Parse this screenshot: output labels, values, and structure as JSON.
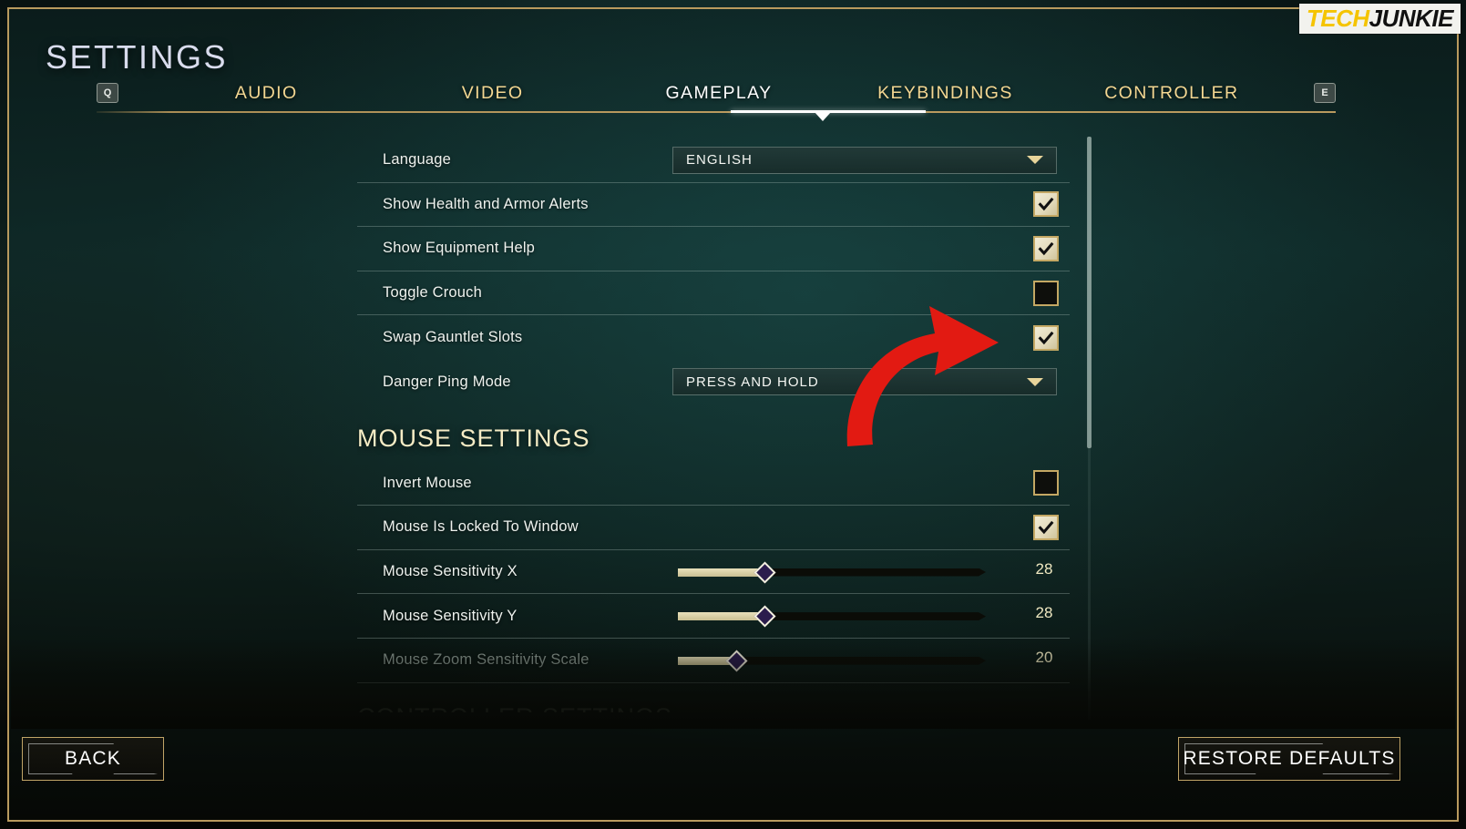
{
  "watermark": {
    "part1": "TECH",
    "part2": "JUNKIE"
  },
  "header": {
    "title": "SETTINGS",
    "key_hint_left": "Q",
    "key_hint_right": "E"
  },
  "tabs": [
    {
      "label": "AUDIO",
      "active": false
    },
    {
      "label": "VIDEO",
      "active": false
    },
    {
      "label": "GAMEPLAY",
      "active": true
    },
    {
      "label": "KEYBINDINGS",
      "active": false
    },
    {
      "label": "CONTROLLER",
      "active": false
    }
  ],
  "settings": {
    "language": {
      "label": "Language",
      "value": "ENGLISH"
    },
    "health_alerts": {
      "label": "Show Health and Armor Alerts",
      "checked": true
    },
    "equipment_help": {
      "label": "Show Equipment Help",
      "checked": true
    },
    "toggle_crouch": {
      "label": "Toggle Crouch",
      "checked": false
    },
    "swap_gauntlet": {
      "label": "Swap Gauntlet Slots",
      "checked": true
    },
    "danger_ping": {
      "label": "Danger Ping Mode",
      "value": "PRESS AND HOLD"
    },
    "mouse_heading": "MOUSE SETTINGS",
    "invert_mouse": {
      "label": "Invert Mouse",
      "checked": false
    },
    "mouse_locked": {
      "label": "Mouse Is Locked To Window",
      "checked": true
    },
    "sens_x": {
      "label": "Mouse Sensitivity X",
      "value": "28",
      "percent": 28
    },
    "sens_y": {
      "label": "Mouse Sensitivity Y",
      "value": "28",
      "percent": 28
    },
    "zoom_scale": {
      "label": "Mouse Zoom Sensitivity Scale",
      "value": "20",
      "percent": 19
    },
    "controller_heading": "CONTROLLER SETTINGS"
  },
  "footer": {
    "back_label": "BACK",
    "restore_label": "RESTORE DEFAULTS"
  },
  "colors": {
    "accent_gold": "#b99a5e",
    "tab_text": "#f3d792",
    "active_tab": "#ffffff",
    "slider_fill": "#e8e0bb",
    "annotation_red": "#e21a12"
  }
}
